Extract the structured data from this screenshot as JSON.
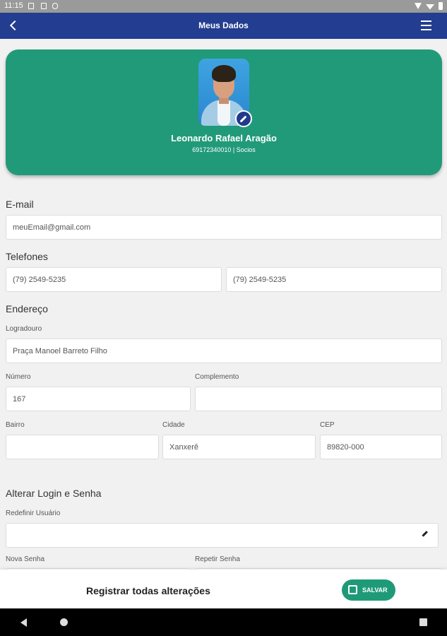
{
  "status_bar": {
    "time": "11:15"
  },
  "app_bar": {
    "title": "Meus Dados"
  },
  "profile": {
    "name": "Leonardo Rafael Aragão",
    "subtitle": "69172340010 | Socios"
  },
  "email": {
    "section": "E-mail",
    "value": "meuEmail@gmail.com"
  },
  "phones": {
    "section": "Telefones",
    "phone1": "(79) 2549-5235",
    "phone2": "(79) 2549-5235"
  },
  "address": {
    "section": "Endereço",
    "logradouro_label": "Logradouro",
    "logradouro": "Praça Manoel Barreto Filho",
    "numero_label": "Número",
    "numero": "167",
    "complemento_label": "Complemento",
    "complemento": "",
    "bairro_label": "Bairro",
    "bairro": "",
    "cidade_label": "Cidade",
    "cidade": "Xanxerê",
    "cep_label": "CEP",
    "cep": "89820-000"
  },
  "login": {
    "section": "Alterar Login e Senha",
    "usuario_label": "Redefinir Usuário",
    "usuario": "",
    "nova_senha_label": "Nova Senha",
    "repetir_senha_label": "Repetir Senha"
  },
  "save_bar": {
    "message": "Registrar todas alterações",
    "button": "SALVAR"
  },
  "colors": {
    "app_bar": "#233d90",
    "card": "#219a79",
    "save_button": "#1f9a78",
    "background": "#f1f1f1"
  }
}
